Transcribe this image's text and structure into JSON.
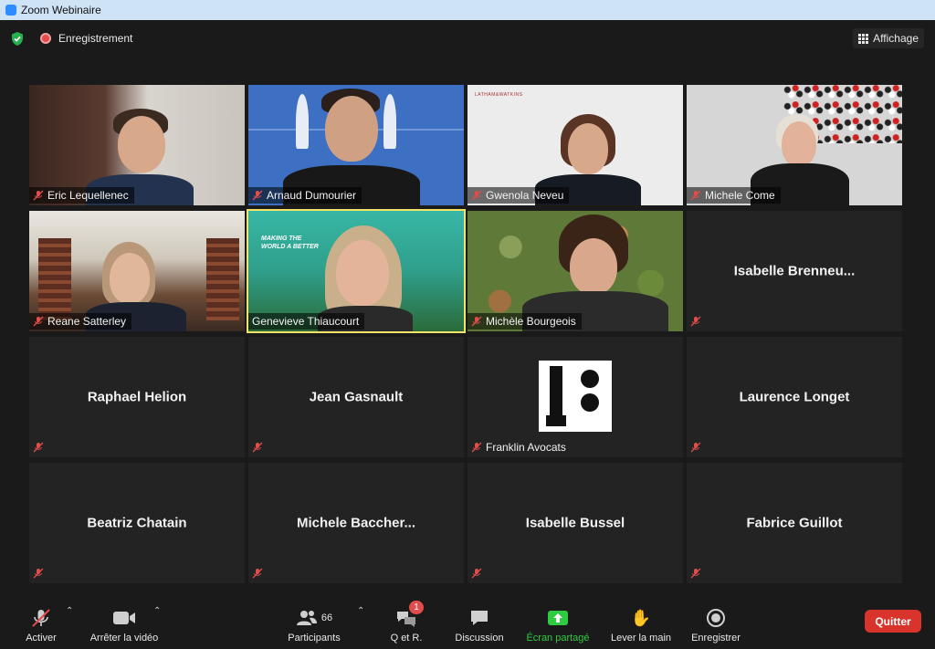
{
  "window": {
    "title": "Zoom Webinaire"
  },
  "topbar": {
    "recording_label": "Enregistrement",
    "view_label": "Affichage"
  },
  "tiles": [
    {
      "name": "Eric Lequellenec",
      "muted": true,
      "video": true
    },
    {
      "name": "Arnaud Dumourier",
      "muted": true,
      "video": true
    },
    {
      "name": "Gwenola Neveu",
      "muted": true,
      "video": true,
      "bg_text": "LATHAM&WATKINS"
    },
    {
      "name": "Michele Come",
      "muted": true,
      "video": true
    },
    {
      "name": "Reane Satterley",
      "muted": true,
      "video": true
    },
    {
      "name": "Genevieve Thiaucourt",
      "muted": false,
      "video": true,
      "active_speaker": true,
      "bg_text": "MAKING THE WORLD A BETTER"
    },
    {
      "name": "Michèle Bourgeois",
      "muted": true,
      "video": true
    },
    {
      "name": "Isabelle  Brenneu...",
      "muted": true,
      "video": false
    },
    {
      "name": "Raphael Helion",
      "muted": true,
      "video": false
    },
    {
      "name": "Jean Gasnault",
      "muted": true,
      "video": false
    },
    {
      "name": "Franklin Avocats",
      "muted": true,
      "video": false,
      "logo": true
    },
    {
      "name": "Laurence Longet",
      "muted": true,
      "video": false
    },
    {
      "name": "Beatriz Chatain",
      "muted": true,
      "video": false
    },
    {
      "name": "Michele  Baccher...",
      "muted": true,
      "video": false
    },
    {
      "name": "Isabelle Bussel",
      "muted": true,
      "video": false
    },
    {
      "name": "Fabrice Guillot",
      "muted": true,
      "video": false
    }
  ],
  "toolbar": {
    "unmute_label": "Activer",
    "stop_video_label": "Arrêter la vidéo",
    "participants_label": "Participants",
    "participants_count": "66",
    "qa_label": "Q et R.",
    "qa_badge": "1",
    "chat_label": "Discussion",
    "share_label": "Écran partagé",
    "raise_hand_label": "Lever la main",
    "record_label": "Enregistrer",
    "quit_label": "Quitter"
  },
  "colors": {
    "accent_green": "#2ecc40",
    "quit_red": "#d9342b",
    "active_outline": "#f2e46b"
  }
}
